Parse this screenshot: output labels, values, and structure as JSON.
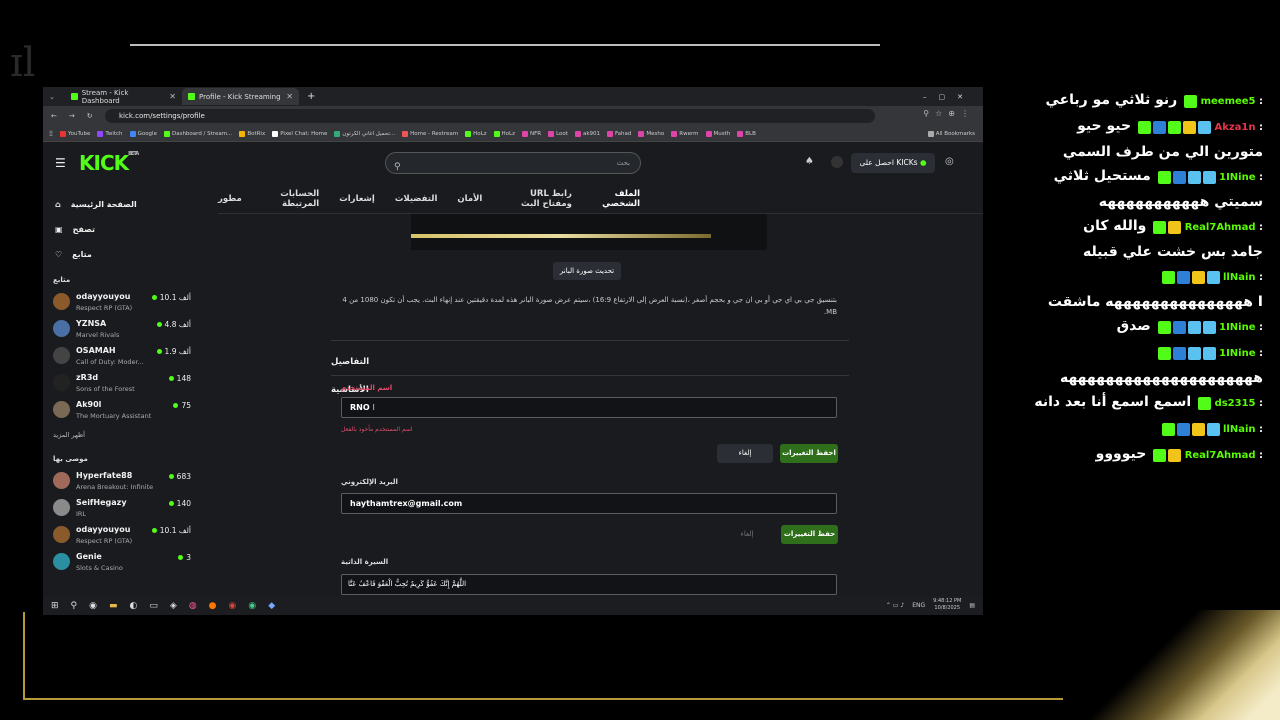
{
  "browser": {
    "tabs": [
      {
        "title": "Stream - Kick Dashboard",
        "active": false
      },
      {
        "title": "Profile - Kick Streaming",
        "active": true
      }
    ],
    "url": "kick.com/settings/profile",
    "bookmarks": [
      "YouTube",
      "Twitch",
      "Google",
      "Dashboard / Stream...",
      "BotRix",
      "Pixel Chat: Home",
      "تحميل اغاني الكرتون...",
      "Home - Restream",
      "HoLz",
      "HoLz",
      "NFR",
      "Loot",
      "ak901",
      "Fahad",
      "Mesho",
      "Rwerm",
      "Musth",
      "BLB",
      "All Bookmarks"
    ]
  },
  "kick": {
    "logo": "KICK",
    "logo_beta": "BETA",
    "search_placeholder": "بحث",
    "get_kicks": "احصل على KICKs",
    "main_nav": [
      "الصفحة الرئيسية",
      "تصفح",
      "متابع"
    ],
    "following_title": "متابع",
    "following": [
      {
        "name": "odayyouyou",
        "game": "Respect RP (GTA)",
        "viewers": "10.1 ألف",
        "avatar": "#8b5a2b"
      },
      {
        "name": "YZNSA",
        "game": "Marvel Rivals",
        "viewers": "4.8 ألف",
        "avatar": "#4a6fa5"
      },
      {
        "name": "OSAMAH",
        "game": "Call of Duty: Moder...",
        "viewers": "1.9 ألف",
        "avatar": "#444444"
      },
      {
        "name": "zR3d",
        "game": "Sons of the Forest",
        "viewers": "148",
        "avatar": "#222222"
      },
      {
        "name": "Ak90l",
        "game": "The Mortuary Assistant",
        "viewers": "75",
        "avatar": "#7a6a55"
      }
    ],
    "show_more": "أظهر المزيد",
    "recommended_title": "موصى بها",
    "recommended": [
      {
        "name": "Hyperfate88",
        "game": "Arena Breakout: Infinite",
        "viewers": "683",
        "avatar": "#a06a5a"
      },
      {
        "name": "SeifHegazy",
        "game": "IRL",
        "viewers": "140",
        "avatar": "#8a8a8a"
      },
      {
        "name": "odayyouyou",
        "game": "Respect RP (GTA)",
        "viewers": "10.1 ألف",
        "avatar": "#8b5a2b"
      },
      {
        "name": "Genie",
        "game": "Slots & Casino",
        "viewers": "3",
        "avatar": "#2a8fa0"
      }
    ],
    "settings_tabs": [
      "الملف الشخصي",
      "رابط URL ومفتاح البث",
      "الأمان",
      "التفضيلات",
      "إشعارات",
      "الحسابات المرتبطة",
      "مطور"
    ],
    "update_banner": "تحديث صورة البانر",
    "banner_note": "بتنسيق جي بي اي جي أو بي ان جي و بحجم أصغر ،(نسبة العرض إلى الارتفاع 16:9) ،سيتم عرض صورة البانر هذه لمدة دقيقتين عند إنهاء البث. يجب أن تكون 1080 من 4 MB.",
    "basic_details": "التفاصيل الأساسية",
    "username_label": "اسم المستخدم",
    "username_value": "RNO",
    "username_hint": "اسم المستخدم مأخوذ بالفعل",
    "save_changes": "احفظ التغييرات",
    "cancel": "إلغاء",
    "email_label": "البريد الإلكتروني",
    "email_value": "haythamtrex@gmail.com",
    "save_changes_2": "حفظ التغييرات",
    "cancel_2": "إلغاء",
    "bio_label": "السيرة الذاتية",
    "bio_value": "اللَّهُمَّ إِنَّكَ عَفُوٌّ كَرِيمٌ تُحِبُّ الْعَفْوَ فَاعْفُ عَنَّا"
  },
  "taskbar": {
    "lang": "ENG",
    "time": "9:48:12 PM",
    "date": "10/8/2025"
  },
  "chat": [
    {
      "user": "meemee5",
      "text": "رنو ثلاثي مو رباعي",
      "badges": [
        "k"
      ],
      "red": false
    },
    {
      "user": "Akza1n",
      "text": "حيو حيو",
      "badges": [
        "k",
        "b",
        "g",
        "y",
        "c"
      ],
      "red": true
    },
    {
      "user": "",
      "text": "متورين الي من طرف السمي",
      "badges": [],
      "red": false
    },
    {
      "user": "1INine",
      "text": "مستحيل ثلاثي",
      "badges": [
        "k",
        "b",
        "c",
        "c"
      ],
      "red": false
    },
    {
      "user": "",
      "text": "سميتي هههههههههههه",
      "badges": [],
      "red": false
    },
    {
      "user": "Real7Ahmad",
      "text": "والله كان",
      "badges": [
        "k",
        "y"
      ],
      "red": false
    },
    {
      "user": "",
      "text": "جامد بس خشت علي قبيله",
      "badges": [],
      "red": false
    },
    {
      "user": "llNain",
      "text": "",
      "badges": [
        "k",
        "b",
        "y",
        "c"
      ],
      "red": false
    },
    {
      "user": "",
      "text": "I هههههههههههههههه ماشقت",
      "badges": [],
      "red": false
    },
    {
      "user": "1INine",
      "text": "صدق",
      "badges": [
        "k",
        "b",
        "c",
        "c"
      ],
      "red": false
    },
    {
      "user": "1INine",
      "text": "",
      "badges": [
        "k",
        "b",
        "c",
        "c"
      ],
      "red": false
    },
    {
      "user": "",
      "text": "هههههههههههههههههههههه",
      "badges": [],
      "red": false
    },
    {
      "user": "ds2315",
      "text": "اسمع اسمع أنا بعد دانه",
      "badges": [
        "k"
      ],
      "red": false
    },
    {
      "user": "llNain",
      "text": "",
      "badges": [
        "k",
        "b",
        "y",
        "c"
      ],
      "red": false
    },
    {
      "user": "Real7Ahmad",
      "text": "حيوووو",
      "badges": [
        "k",
        "y"
      ],
      "red": false
    }
  ]
}
